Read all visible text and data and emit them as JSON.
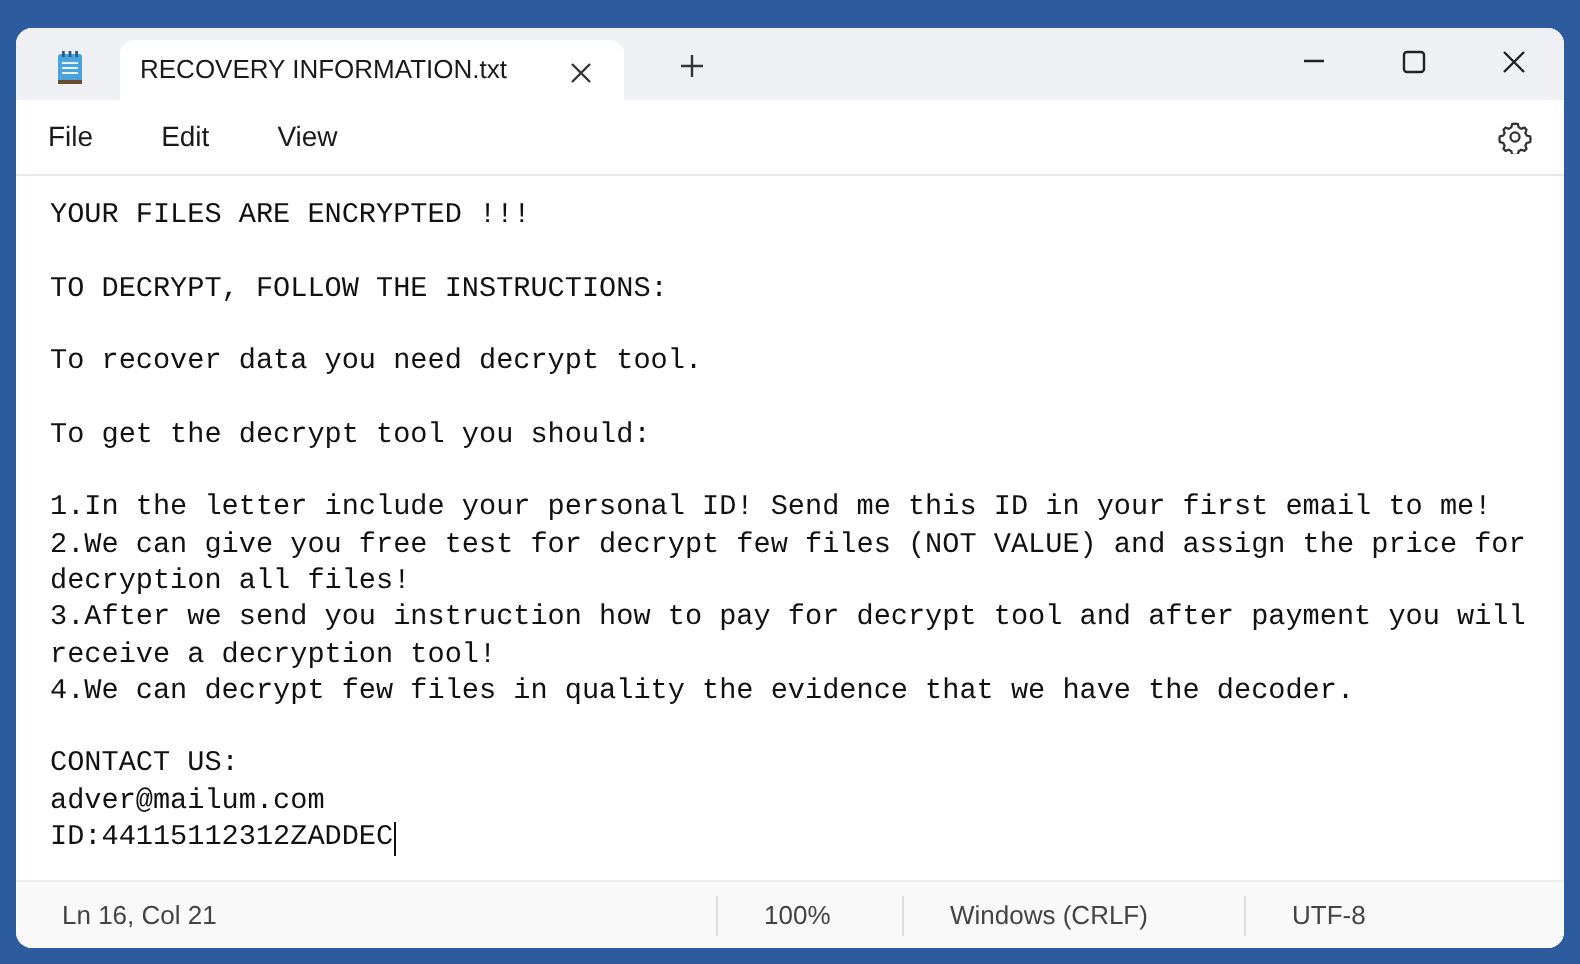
{
  "tab": {
    "title": "RECOVERY INFORMATION.txt",
    "selected": true
  },
  "menu": [
    "File",
    "Edit",
    "View"
  ],
  "blocks": [
    {
      "lines": [
        "YOUR FILES ARE ENCRYPTED !!!"
      ]
    },
    {
      "lines": [
        "TO DECRYPT, FOLLOW THE INSTRUCTIONS:"
      ]
    },
    {
      "lines": [
        "To recover data you need decrypt tool."
      ]
    },
    {
      "lines": [
        "To get the decrypt tool you should:"
      ]
    },
    {
      "lines": [
        "1.In the letter include your personal ID! Send me this ID in your first email to me!",
        "2.We can give you free test for decrypt few files (NOT VALUE) and assign the price for",
        "decryption all files!",
        "3.After we send you instruction how to pay for decrypt tool and after payment you will",
        "receive a decryption tool!",
        "4.We can decrypt few files in quality the evidence that we have the decoder."
      ]
    },
    {
      "lines": [
        "CONTACT US:",
        "adver@mailum.com",
        "ID:44115112312ZADDEC"
      ]
    }
  ],
  "status_bar": {
    "position": "Ln 16, Col 21",
    "zoom": "100%",
    "line_endings": "Windows (CRLF)",
    "encoding": "UTF-8"
  }
}
